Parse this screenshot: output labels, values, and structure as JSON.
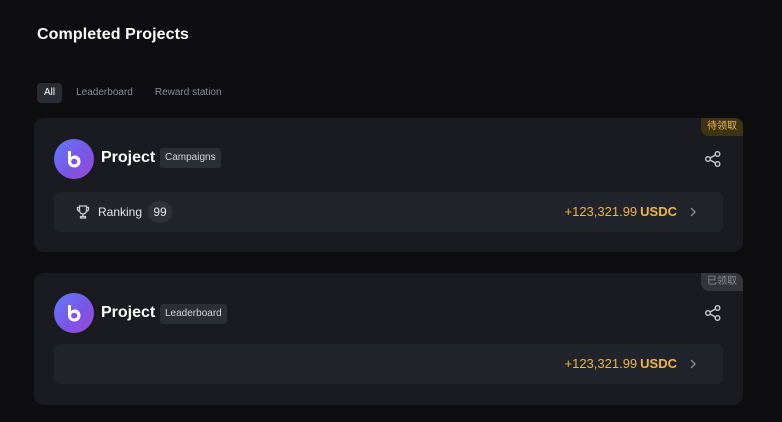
{
  "page": {
    "title": "Completed Projects"
  },
  "tabs": [
    {
      "label": "All",
      "active": true
    },
    {
      "label": "Leaderboard",
      "active": false
    },
    {
      "label": "Reward station",
      "active": false
    }
  ],
  "projects": [
    {
      "name": "Project",
      "category": "Campaigns",
      "status": "待领取",
      "ranking_label": "Ranking",
      "ranking_value": "99",
      "amount": "+123,321.99",
      "currency": "USDC"
    },
    {
      "name": "Project",
      "category": "Leaderboard",
      "status": "已领取",
      "amount": "+123,321.99",
      "currency": "USDC"
    }
  ],
  "icons": {
    "avatar": "project-logo-icon",
    "share": "share-icon",
    "ranking": "trophy-icon",
    "chevron": "chevron-right-icon"
  },
  "colors": {
    "background": "#0e0e11",
    "card": "#1a1b20",
    "row": "#22242c",
    "amount": "#f0b73b",
    "pending_tag": "#3e3414",
    "claimed_tag": "#34363c"
  }
}
